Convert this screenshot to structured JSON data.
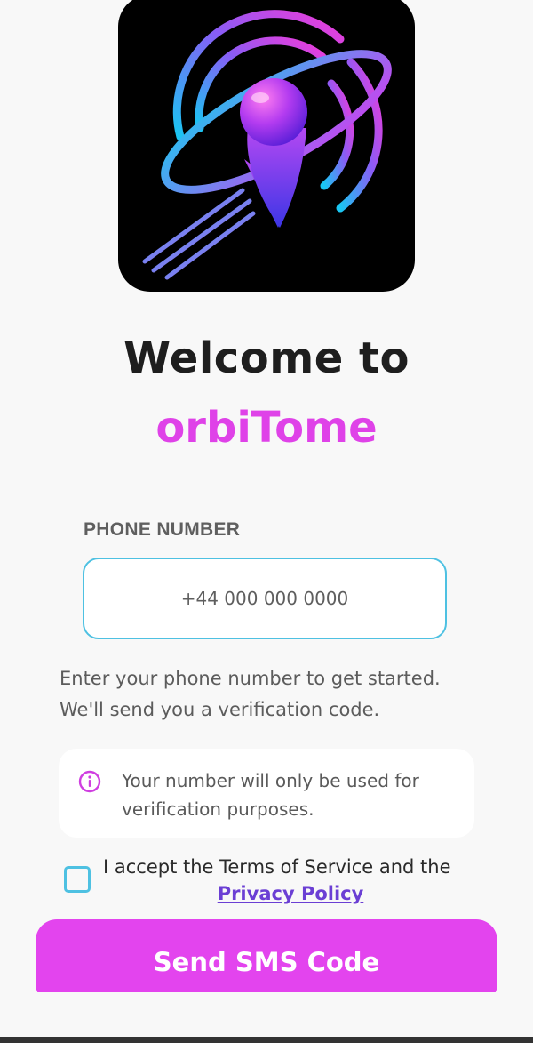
{
  "header": {
    "welcome": "Welcome to",
    "brand": "orbiTome"
  },
  "phone": {
    "label": "PHONE NUMBER",
    "placeholder": "+44 000 000 0000",
    "value": ""
  },
  "helper": {
    "line1": "Enter your phone number to get started.",
    "line2": "We'll send you a verification code."
  },
  "info": {
    "icon": "info-icon",
    "text": "Your number will only be used for verification purposes."
  },
  "terms": {
    "checked": false,
    "text": "I accept the Terms of Service and the",
    "link": "Privacy Policy"
  },
  "actions": {
    "send": "Send SMS Code"
  },
  "colors": {
    "accent": "#e344ee",
    "brand": "#df42e8",
    "input_border": "#4ec1e2",
    "link": "#6b3fd4"
  }
}
